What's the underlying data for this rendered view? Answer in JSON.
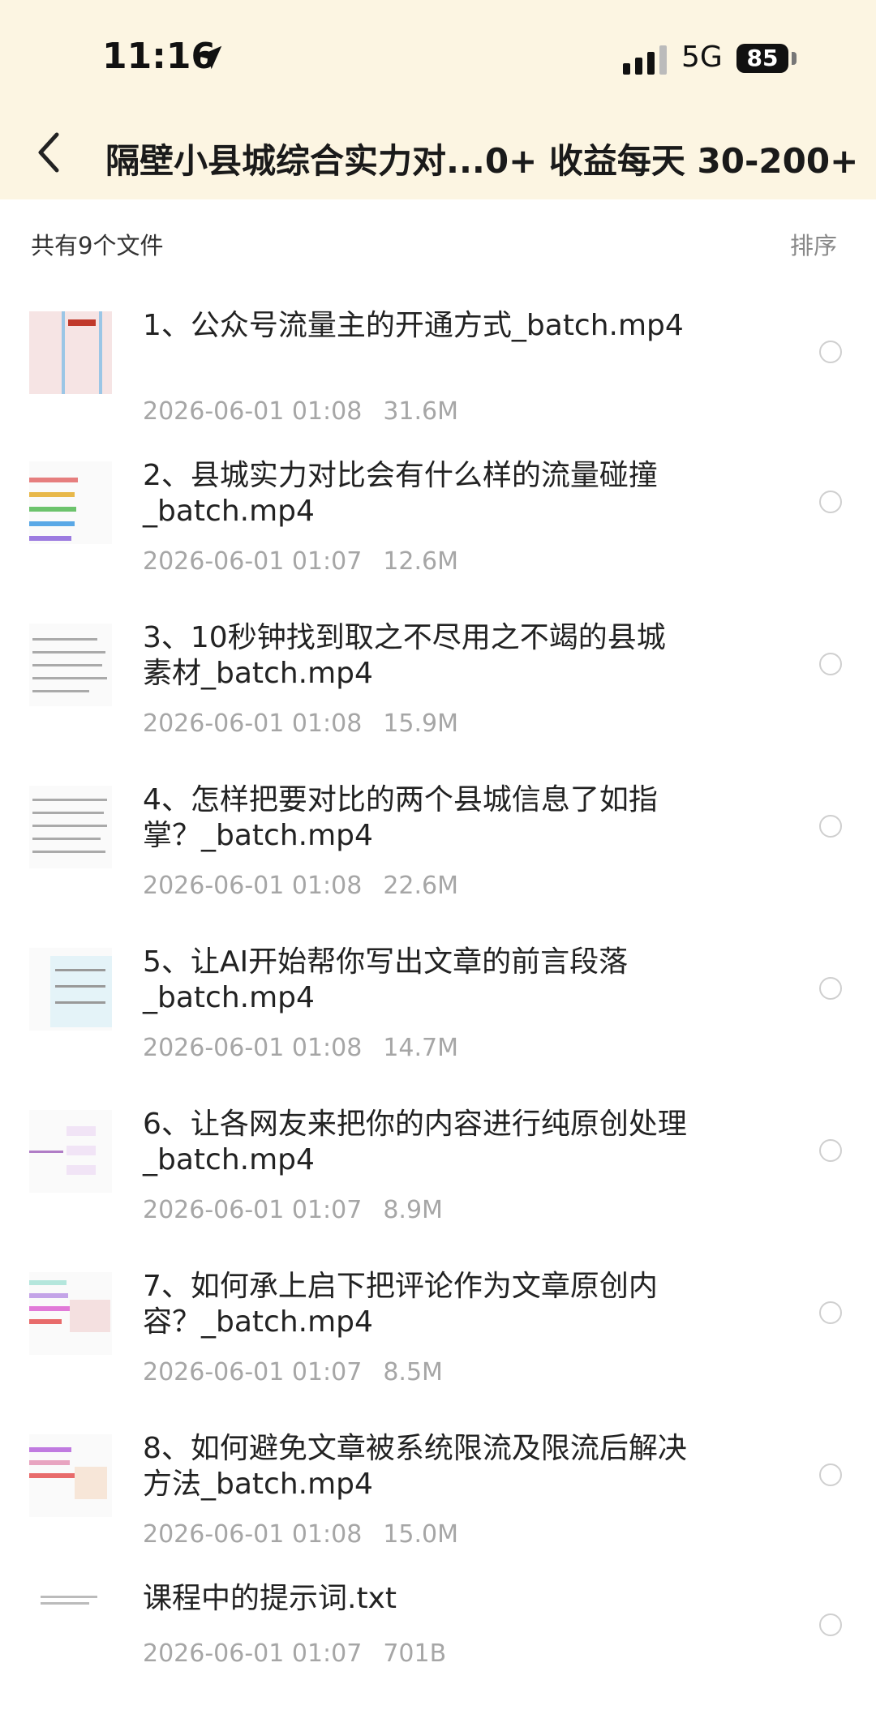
{
  "status_bar": {
    "time": "11:16",
    "network": "5G",
    "battery": "85"
  },
  "header": {
    "title": "隔壁小县城综合实力对...0+  收益每天 30-200+"
  },
  "summary": {
    "file_count": "共有9个文件",
    "sort_label": "排序"
  },
  "files": [
    {
      "name": "1、公众号流量主的开通方式_batch.mp4",
      "date": "2026-06-01 01:08",
      "size": "31.6M"
    },
    {
      "name": "2、县城实力对比会有什么样的流量碰撞_batch.mp4",
      "date": "2026-06-01 01:07",
      "size": "12.6M"
    },
    {
      "name": "3、10秒钟找到取之不尽用之不竭的县城素材_batch.mp4",
      "date": "2026-06-01 01:08",
      "size": "15.9M"
    },
    {
      "name": "4、怎样把要对比的两个县城信息了如指掌？_batch.mp4",
      "date": "2026-06-01 01:08",
      "size": "22.6M"
    },
    {
      "name": "5、让AI开始帮你写出文章的前言段落_batch.mp4",
      "date": "2026-06-01 01:08",
      "size": "14.7M"
    },
    {
      "name": "6、让各网友来把你的内容进行纯原创处理_batch.mp4",
      "date": "2026-06-01 01:07",
      "size": "8.9M"
    },
    {
      "name": "7、如何承上启下把评论作为文章原创内容？_batch.mp4",
      "date": "2026-06-01 01:07",
      "size": "8.5M"
    },
    {
      "name": "8、如何避免文章被系统限流及限流后解决方法_batch.mp4",
      "date": "2026-06-01 01:08",
      "size": "15.0M"
    },
    {
      "name": "课程中的提示词.txt",
      "date": "2026-06-01 01:07",
      "size": "701B"
    }
  ]
}
